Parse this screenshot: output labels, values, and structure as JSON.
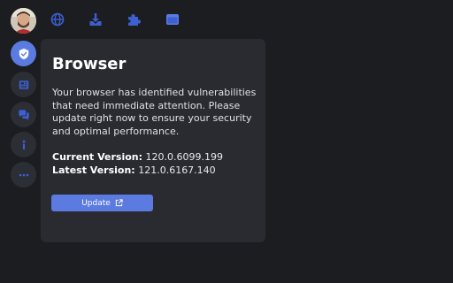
{
  "sidebar": {
    "items": [
      {
        "icon": "shield-check-icon",
        "active": true
      },
      {
        "icon": "newspaper-icon",
        "active": false
      },
      {
        "icon": "chat-bubbles-icon",
        "active": false
      },
      {
        "icon": "info-icon",
        "active": false
      },
      {
        "icon": "more-icon",
        "active": false
      }
    ]
  },
  "topbar": {
    "icons": [
      "globe-icon",
      "download-icon",
      "puzzle-icon",
      "browser-window-icon"
    ]
  },
  "panel": {
    "title": "Browser",
    "description": "Your browser has identified vulnerabilities that need immediate attention. Please update right now to ensure your security and optimal performance.",
    "current_version_label": "Current Version:",
    "current_version": "120.0.6099.199",
    "latest_version_label": "Latest Version:",
    "latest_version": "121.0.6167.140",
    "update_label": "Update"
  },
  "colors": {
    "background": "#1c1d21",
    "panel": "#2a2b31",
    "accent": "#5b7be0",
    "icon_blue": "#3d5fcf"
  }
}
